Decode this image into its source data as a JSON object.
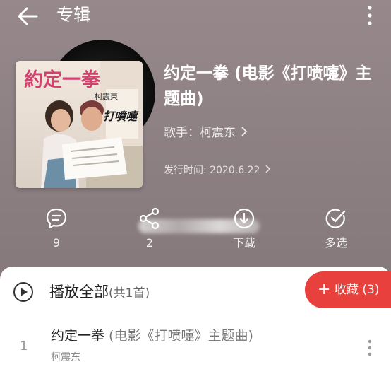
{
  "header": {
    "title": "专辑",
    "back_icon": "arrow-left-icon",
    "more_icon": "vertical-dots-icon"
  },
  "album": {
    "title": "约定一拳 (电影《打喷嚏》主题曲)",
    "singer_label": "歌手：柯震东",
    "release_label": "发行时间: 2020.6.22",
    "cover_art": {
      "title_text": "約定一拳",
      "artist_text": "柯震東",
      "movie_text": "打噴嚏"
    }
  },
  "actions": [
    {
      "icon": "comment-icon",
      "label": "9"
    },
    {
      "icon": "share-icon",
      "label": "2"
    },
    {
      "icon": "download-icon",
      "label": "下载"
    },
    {
      "icon": "multi-select-icon",
      "label": "多选"
    }
  ],
  "list": {
    "play_all_label": "播放全部",
    "play_all_count": "(共1首)",
    "collect_label": "收藏 (3)",
    "songs": [
      {
        "index": "1",
        "title": "约定一拳",
        "subtitle": " (电影《打喷嚏》主题曲)",
        "artist": "柯震东"
      }
    ]
  },
  "colors": {
    "background": "#8f8284",
    "accent": "#e8413d",
    "sheet": "#ffffff"
  }
}
